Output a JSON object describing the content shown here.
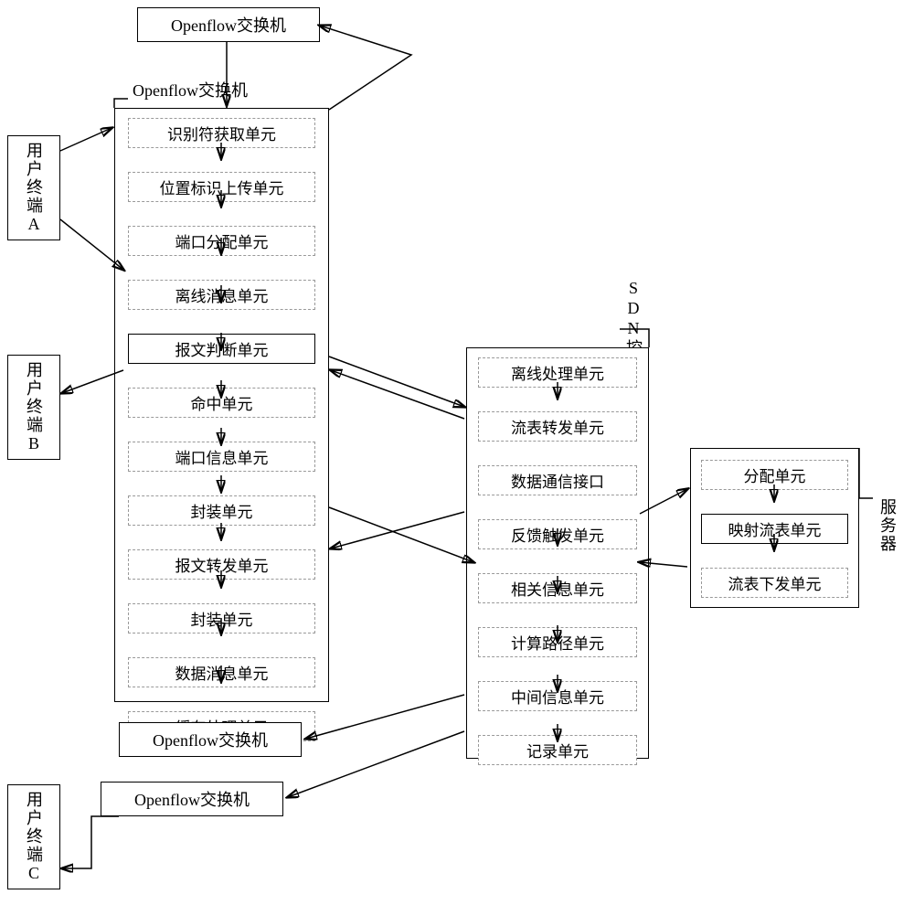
{
  "terminals": {
    "a": "用户终端A",
    "b": "用户终端B",
    "c": "用户终端C"
  },
  "switches": {
    "top": "Openflow交换机",
    "main_label": "Openflow交换机",
    "bottom1": "Openflow交换机",
    "bottom2": "Openflow交换机"
  },
  "switch_units": {
    "u1": "识别符获取单元",
    "u2": "位置标识上传单元",
    "u3": "端口分配单元",
    "u4": "离线消息单元",
    "u5": "报文判断单元",
    "u6": "命中单元",
    "u7": "端口信息单元",
    "u8": "封装单元",
    "u9": "报文转发单元",
    "u10": "封装单元",
    "u11": "数据消息单元",
    "u12": "缓存处理单元"
  },
  "controller": {
    "label": "SDN控制器",
    "c1": "离线处理单元",
    "c2": "流表转发单元",
    "c3": "数据通信接口",
    "c4": "反馈触发单元",
    "c5": "相关信息单元",
    "c6": "计算路径单元",
    "c7": "中间信息单元",
    "c8": "记录单元"
  },
  "server": {
    "label": "服务器",
    "s1": "分配单元",
    "s2": "映射流表单元",
    "s3": "流表下发单元"
  }
}
